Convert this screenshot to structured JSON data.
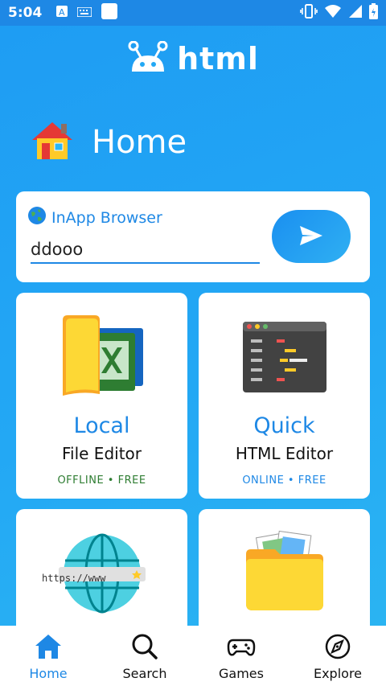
{
  "status_bar": {
    "time": "5:04"
  },
  "brand": {
    "name": "html"
  },
  "page": {
    "title": "Home"
  },
  "browser": {
    "label": "InApp Browser",
    "url_value": "ddooo"
  },
  "cards": [
    {
      "title": "Local",
      "subtitle": "File Editor",
      "tag": "OFFLINE • FREE",
      "tag_color": "#2e7d32"
    },
    {
      "title": "Quick",
      "subtitle": "HTML Editor",
      "tag": "ONLINE • FREE",
      "tag_color": "#1e88e5"
    }
  ],
  "cards_partial": [
    {
      "art_text": "https://www"
    }
  ],
  "nav": [
    {
      "label": "Home",
      "icon": "home-icon",
      "active": true
    },
    {
      "label": "Search",
      "icon": "search-icon"
    },
    {
      "label": "Games",
      "icon": "gamepad-icon"
    },
    {
      "label": "Explore",
      "icon": "compass-icon"
    }
  ],
  "colors": {
    "accent": "#1e88e5",
    "background": "#23a8f4"
  }
}
